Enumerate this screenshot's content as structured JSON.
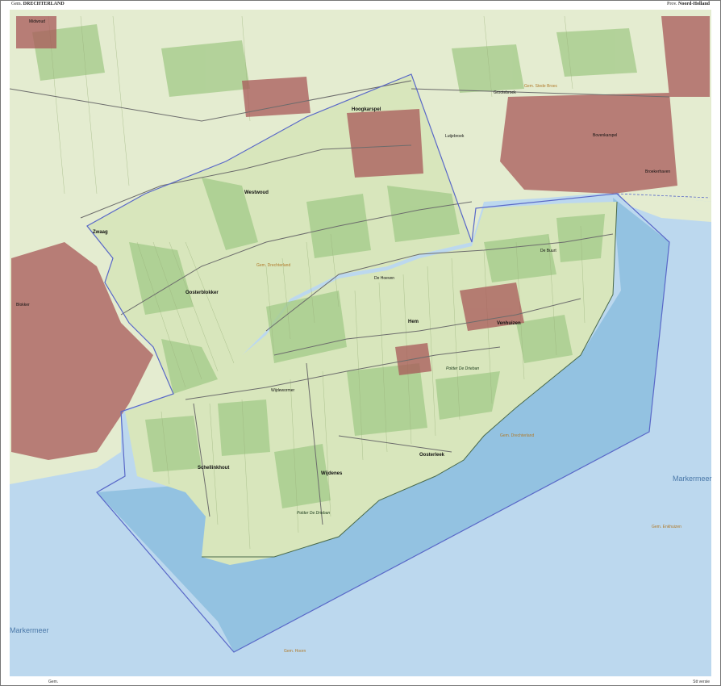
{
  "header": {
    "left_prefix": "Gem.",
    "left_title": "DRECHTERLAND",
    "right_prefix": "Prov.",
    "right_title": "Noord-Holland"
  },
  "footer": {
    "left": "Gem.",
    "right": "Stt versie"
  },
  "colors": {
    "water": "#bcd8ee",
    "municipality_water": "#8cbede",
    "land": "#e4ecd0",
    "polder_green": "#a6cc8c",
    "urban": "#a85858",
    "boundary": "#5968c8",
    "road": "#6c6c6c"
  },
  "labels": {
    "hoogkarspel": "Hoogkarspel",
    "westwoud": "Westwoud",
    "zwaag": "Zwaag",
    "oosterblokker": "Oosterblokker",
    "venhuizen": "Venhuizen",
    "hem": "Hem",
    "wijdenes": "Wijdenes",
    "oosterleek": "Oosterleek",
    "schellinkhout": "Schellinkhout",
    "grootebroek": "Grootebroek",
    "lutjebroek": "Lutjebroek",
    "bovenkarspel": "Bovenkarspel",
    "broekerhaven": "Broekerhaven",
    "wijdewormer": "Wijdewormer",
    "de_hoeven": "De Hoeven",
    "de_buurt": "De Buurt",
    "blokker": "Blokker",
    "midwoud": "Midwoud",
    "polder_drieban": "Polder De Drieban",
    "gem_drechterland": "Gem. Drechterland",
    "gem_enkhuizen": "Gem. Enkhuizen",
    "gem_hoorn": "Gem. Hoorn",
    "gem_stede_broec": "Gem. Stede Broec",
    "markermeer_east": "Markermeer",
    "markermeer_west": "Markermeer"
  }
}
